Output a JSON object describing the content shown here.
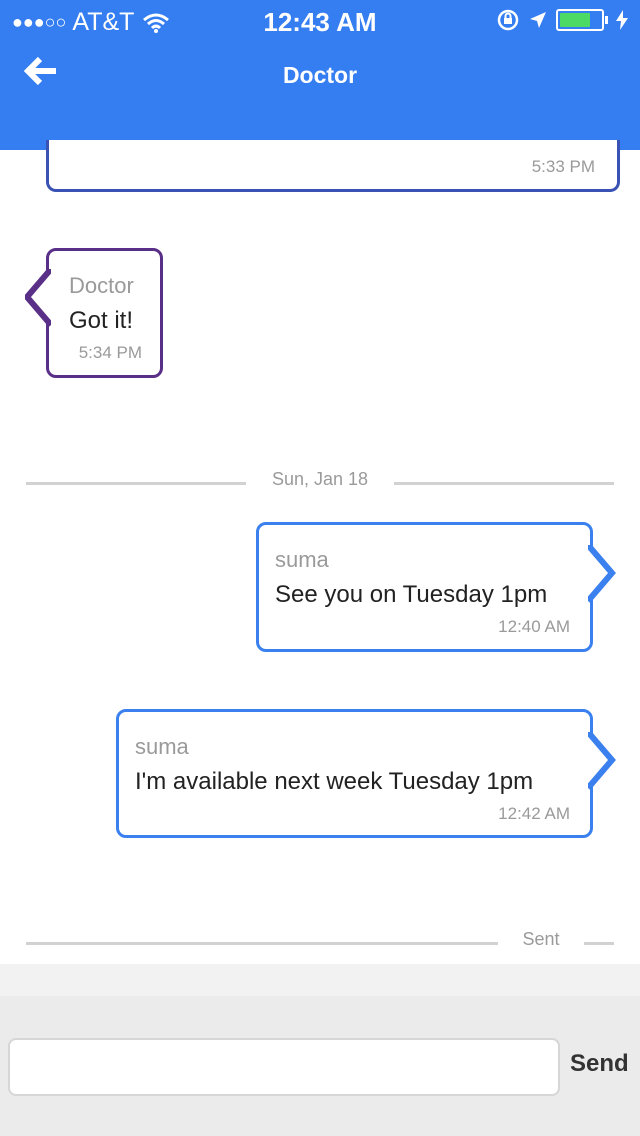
{
  "status_bar": {
    "signal_dots": "●●●○○",
    "carrier": "AT&T",
    "time": "12:43 AM",
    "icons": [
      "wifi-icon",
      "rotation-lock-icon",
      "location-arrow-icon",
      "battery-icon",
      "charging-icon"
    ],
    "battery_level": 0.8
  },
  "nav": {
    "title": "Doctor",
    "back_icon": "arrow-left-icon"
  },
  "messages": [
    {
      "sender": "",
      "text": "",
      "time": "5:33 PM"
    },
    {
      "sender": "Doctor",
      "text": "Got it!",
      "time": "5:34 PM"
    },
    {
      "sender": "suma",
      "text": "See you on Tuesday 1pm",
      "time": "12:40 AM"
    },
    {
      "sender": "suma",
      "text": "I'm available next week Tuesday 1pm",
      "time": "12:42 AM"
    }
  ],
  "dividers": {
    "date": "Sun, Jan 18",
    "status": "Sent"
  },
  "composer": {
    "value": "",
    "placeholder": "",
    "send_label": "Send"
  },
  "colors": {
    "header": "#357ef1",
    "doctor_bubble_border": "#5a2f88",
    "user_bubble_border": "#3a80ee",
    "older_bubble_border": "#3a52b3"
  }
}
